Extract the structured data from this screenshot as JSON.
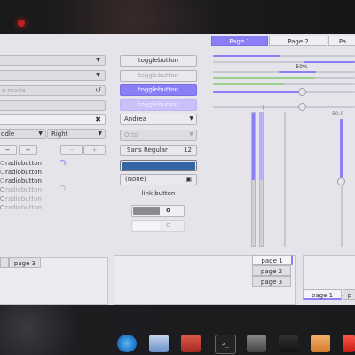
{
  "window": {
    "notebook_tabs": [
      "Page 1",
      "Page 2",
      "Pa"
    ],
    "col1": {
      "mode_entry": "e mode",
      "combo_align": "ddle",
      "combo_right": "Right",
      "radios": [
        "radiobutton",
        "radiobutton",
        "radiobutton",
        "radiobutton",
        "radiobutton",
        "radiobutton"
      ],
      "spin_minus": "−",
      "spin_plus": "+"
    },
    "col2": {
      "togglebuttons": [
        "togglebutton",
        "togglebutton",
        "togglebutton",
        "togglebutton"
      ],
      "combo_font_family": "Andrea",
      "combo_disabled": "Otto",
      "font_button_label": "Sans Regular",
      "font_button_size": "12",
      "file_button_label": "(None)",
      "link_button": "link button",
      "switch1_state": "0",
      "switch2_state": "O"
    },
    "col3": {
      "progress_label": "50%",
      "vscale_value": "50.0"
    },
    "bottom": {
      "left_tab": "page 3",
      "vertical_tabs": [
        "page 1",
        "page 2",
        "page 3"
      ],
      "bottom_tabs": [
        "page 1",
        "p"
      ]
    }
  },
  "dock": {
    "apps": [
      "safari-icon",
      "finder-icon",
      "toolbox-icon",
      "terminal-icon",
      "video-icon",
      "clapper-icon",
      "folder-icon",
      "acrobat-icon"
    ]
  },
  "colors": {
    "accent": "#8b7ff6",
    "accent_disabled": "#c9c2fa",
    "green_level": "#9bd08a",
    "window_bg": "#e4e4ea"
  }
}
